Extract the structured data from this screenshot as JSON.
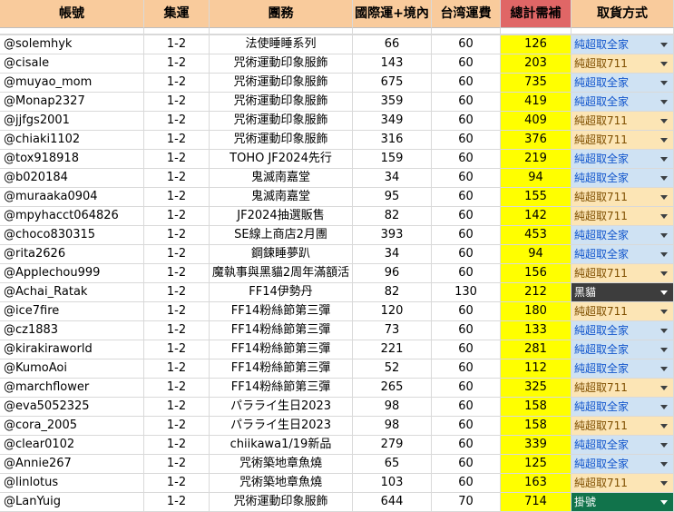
{
  "headers": [
    "帳號",
    "集運",
    "團務",
    "國際運+境內",
    "台湾運費",
    "總計需補",
    "取貨方式"
  ],
  "option_colors": {
    "純超取全家": {
      "bg": "#cfe2f3",
      "fg": "#1155cc"
    },
    "純超取711": {
      "bg": "#fce5b5",
      "fg": "#7f4f00"
    },
    "黑貓": {
      "bg": "#3d3d3d",
      "fg": "#ffffff"
    },
    "掛號": {
      "bg": "#11734b",
      "fg": "#ffffff"
    }
  },
  "rows": [
    {
      "account": "@solemhyk",
      "ship": "1-2",
      "group": "法使睡睡系列",
      "intl": "66",
      "tw": "60",
      "total": "126",
      "pickup": "純超取全家"
    },
    {
      "account": "@cisale",
      "ship": "1-2",
      "group": "咒術運動印象服飾",
      "intl": "143",
      "tw": "60",
      "total": "203",
      "pickup": "純超取711"
    },
    {
      "account": "@muyao_mom",
      "ship": "1-2",
      "group": "咒術運動印象服飾",
      "intl": "675",
      "tw": "60",
      "total": "735",
      "pickup": "純超取全家"
    },
    {
      "account": "@Monap2327",
      "ship": "1-2",
      "group": "咒術運動印象服飾",
      "intl": "359",
      "tw": "60",
      "total": "419",
      "pickup": "純超取全家"
    },
    {
      "account": "@jjfgs2001",
      "ship": "1-2",
      "group": "咒術運動印象服飾",
      "intl": "349",
      "tw": "60",
      "total": "409",
      "pickup": "純超取711"
    },
    {
      "account": "@chiaki1102",
      "ship": "1-2",
      "group": "咒術運動印象服飾",
      "intl": "316",
      "tw": "60",
      "total": "376",
      "pickup": "純超取711"
    },
    {
      "account": "@tox918918",
      "ship": "1-2",
      "group": "TOHO JF2024先行",
      "intl": "159",
      "tw": "60",
      "total": "219",
      "pickup": "純超取全家"
    },
    {
      "account": "@b020184",
      "ship": "1-2",
      "group": "鬼滅南嘉堂",
      "intl": "34",
      "tw": "60",
      "total": "94",
      "pickup": "純超取全家"
    },
    {
      "account": "@muraaka0904",
      "ship": "1-2",
      "group": "鬼滅南嘉堂",
      "intl": "95",
      "tw": "60",
      "total": "155",
      "pickup": "純超取711"
    },
    {
      "account": "@mpyhacct064826",
      "ship": "1-2",
      "group": "JF2024抽選販售",
      "intl": "82",
      "tw": "60",
      "total": "142",
      "pickup": "純超取711"
    },
    {
      "account": "@choco830315",
      "ship": "1-2",
      "group": "SE線上商店2月團",
      "intl": "393",
      "tw": "60",
      "total": "453",
      "pickup": "純超取全家"
    },
    {
      "account": "@rita2626",
      "ship": "1-2",
      "group": "鋼鍊睡夢趴",
      "intl": "34",
      "tw": "60",
      "total": "94",
      "pickup": "純超取全家"
    },
    {
      "account": "@Applechou999",
      "ship": "1-2",
      "group": "魔執事與黑貓2周年滿額活",
      "intl": "96",
      "tw": "60",
      "total": "156",
      "pickup": "純超取711"
    },
    {
      "account": "@Achai_Ratak",
      "ship": "1-2",
      "group": "FF14伊勢丹",
      "intl": "82",
      "tw": "130",
      "total": "212",
      "pickup": "黑貓"
    },
    {
      "account": "@ice7fire",
      "ship": "1-2",
      "group": "FF14粉絲節第三彈",
      "intl": "120",
      "tw": "60",
      "total": "180",
      "pickup": "純超取711"
    },
    {
      "account": "@cz1883",
      "ship": "1-2",
      "group": "FF14粉絲節第三彈",
      "intl": "73",
      "tw": "60",
      "total": "133",
      "pickup": "純超取全家"
    },
    {
      "account": "@kirakiraworld",
      "ship": "1-2",
      "group": "FF14粉絲節第三彈",
      "intl": "221",
      "tw": "60",
      "total": "281",
      "pickup": "純超取全家"
    },
    {
      "account": "@KumoAoi",
      "ship": "1-2",
      "group": "FF14粉絲節第三彈",
      "intl": "52",
      "tw": "60",
      "total": "112",
      "pickup": "純超取全家"
    },
    {
      "account": "@marchflower",
      "ship": "1-2",
      "group": "FF14粉絲節第三彈",
      "intl": "265",
      "tw": "60",
      "total": "325",
      "pickup": "純超取711"
    },
    {
      "account": "@eva5052325",
      "ship": "1-2",
      "group": "パラライ生日2023",
      "intl": "98",
      "tw": "60",
      "total": "158",
      "pickup": "純超取全家"
    },
    {
      "account": "@cora_2005",
      "ship": "1-2",
      "group": "パラライ生日2023",
      "intl": "98",
      "tw": "60",
      "total": "158",
      "pickup": "純超取711"
    },
    {
      "account": "@clear0102",
      "ship": "1-2",
      "group": "chiikawa1/19新品",
      "intl": "279",
      "tw": "60",
      "total": "339",
      "pickup": "純超取全家"
    },
    {
      "account": "@Annie267",
      "ship": "1-2",
      "group": "咒術築地章魚燒",
      "intl": "65",
      "tw": "60",
      "total": "125",
      "pickup": "純超取全家"
    },
    {
      "account": "@linlotus",
      "ship": "1-2",
      "group": "咒術築地章魚燒",
      "intl": "103",
      "tw": "60",
      "total": "163",
      "pickup": "純超取711"
    },
    {
      "account": "@LanYuig",
      "ship": "1-2",
      "group": "咒術運動印象服飾",
      "intl": "644",
      "tw": "70",
      "total": "714",
      "pickup": "掛號"
    }
  ]
}
